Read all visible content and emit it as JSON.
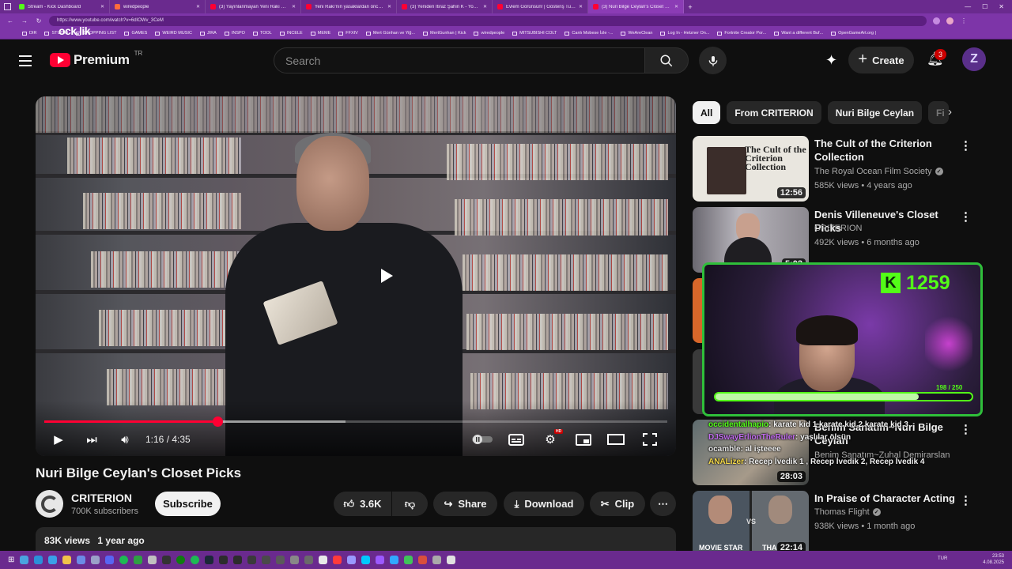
{
  "browser": {
    "tabs": [
      {
        "title": "Stream - Kick Dashboard",
        "color": "#53fc18"
      },
      {
        "title": "wiredpeople",
        "color": "#ff6b3d"
      },
      {
        "title": "(3) Yayınlanmayan Yeni Rakı Reklamı",
        "color": "#ff0033"
      },
      {
        "title": "Yeni Rakı'nın yasaklardan önceki...",
        "color": "#ff0033"
      },
      {
        "title": "(3) Yeniden İtiraz Şahin K - YouTube",
        "color": "#ff0033"
      },
      {
        "title": "Evlem Görünsün! | Gösteriş Tutkusu",
        "color": "#ff0033"
      },
      {
        "title": "(3) Nuri Bilge Ceylan's Closet Picks",
        "color": "#ff0033",
        "active": true
      }
    ],
    "url": "https://www.youtube.com/watch?v=6dIOWv_3CeM",
    "bookmarks": [
      "DIR",
      "STUDIO",
      "SHOPPING LIST",
      "GAMES",
      "WEIRD MUSIC",
      "JIRA",
      "INSPO",
      "TOOL",
      "INCELE",
      "MEME",
      "FFXIV",
      "Mert Günhan ve Yiğ...",
      "MertGunhan | Kick",
      "wiredpeople",
      "MITSUBISHI COLT",
      "Canlı Mobese İzle -...",
      "WeAreClean",
      "Log In - Hetzner On...",
      "Fortnite Creator Por...",
      "Want a different Buf...",
      "OpenGameArt.org |"
    ],
    "overlay_logo": "ock.lik"
  },
  "header": {
    "brand": "Premium",
    "country": "TR",
    "search_placeholder": "Search",
    "create_label": "Create",
    "notifications": "3",
    "avatar_initial": "Z"
  },
  "player": {
    "time_current": "1:16",
    "time_total": "4:35",
    "time_display": "1:16 / 4:35",
    "progress": 0.2776,
    "buffered": 0.483,
    "hd_badge": "HD"
  },
  "video": {
    "title": "Nuri Bilge Ceylan's Closet Picks",
    "channel": "CRITERION",
    "subscribers": "700K subscribers",
    "subscribe_label": "Subscribe",
    "likes": "3.6K",
    "share_label": "Share",
    "download_label": "Download",
    "clip_label": "Clip",
    "views": "83K views",
    "age": "1 year ago"
  },
  "chips": [
    "All",
    "From CRITERION",
    "Nuri Bilge Ceylan",
    "Fi"
  ],
  "recommendations": [
    {
      "title": "The Cult of the Criterion Collection",
      "channel": "The Royal Ocean Film Society",
      "verified": true,
      "views": "585K views",
      "age": "4 years ago",
      "duration": "12:56",
      "thumb_text": "The Cult of the Criterion Collection"
    },
    {
      "title": "Denis Villeneuve's Closet Picks",
      "channel": "CRITERION",
      "verified": false,
      "views": "492K views",
      "age": "6 months ago",
      "duration": "5:02"
    },
    {
      "title": "Benim Sanatım~Nuri Bilge Ceylan",
      "channel": "Benim Sanatım~Zuhal Demirarslan",
      "verified": false,
      "views": "",
      "age": "",
      "duration": "28:03"
    },
    {
      "title": "In Praise of Character Acting",
      "channel": "Thomas Flight",
      "verified": true,
      "views": "938K views",
      "age": "1 month ago",
      "duration": "22:14",
      "thumb_left": "MOVIE STAR",
      "thumb_vs": "VS",
      "thumb_right": "THA"
    }
  ],
  "stream": {
    "kick_logo": "K",
    "viewer_count": "1259",
    "goal_current": 198,
    "goal_total": 250,
    "goal_label": "198 / 250",
    "chat": [
      {
        "user": "occidentalhapio",
        "msg": "karate kid 1 karate kid 2 karate kid 3",
        "color": "#53fc18"
      },
      {
        "user": "DJSwayErlionTheRuler",
        "msg": "yaşlılar ölsün",
        "color": "#c26cf0"
      },
      {
        "user": "ocamble",
        "msg": "al işteeee",
        "color": "#e7e7e7"
      },
      {
        "user": "ANALizer",
        "msg": "Recep İvedik 1 , Recep İvedik 2, Recep İvedik 4",
        "color": "#f5d94a"
      }
    ]
  },
  "taskbar": {
    "lang": "TUR",
    "time": "23:53",
    "date": "4.08.2025"
  },
  "colors": {
    "accent": "#ff0033",
    "kick": "#53fc18",
    "browser_frame": "#7d35a8"
  }
}
